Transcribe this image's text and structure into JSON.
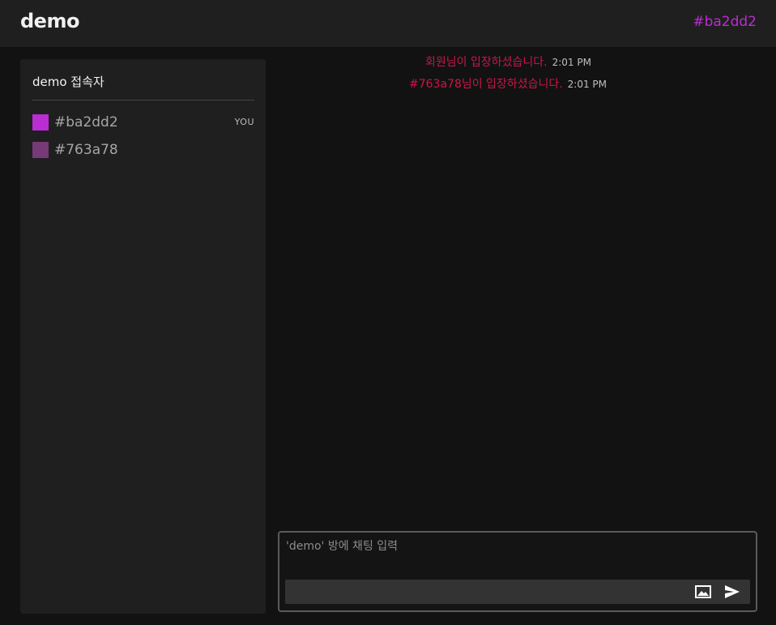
{
  "header": {
    "title": "demo",
    "current_user": "#ba2dd2",
    "current_user_color": "#ba2dd2"
  },
  "sidebar": {
    "title": "demo 접속자",
    "users": [
      {
        "name": "#ba2dd2",
        "color": "#ba2dd2",
        "tag": "YOU"
      },
      {
        "name": "#763a78",
        "color": "#763a78",
        "tag": ""
      }
    ]
  },
  "messages": [
    {
      "text": "회원님이 입장하셨습니다.",
      "time": "2:01 PM"
    },
    {
      "text": "#763a78님이 입장하셨습니다.",
      "time": "2:01 PM"
    }
  ],
  "composer": {
    "placeholder": "'demo' 방에 채팅 입력",
    "image_icon": "image-icon",
    "send_icon": "send-icon"
  },
  "colors": {
    "system_message": "#c8164a",
    "background": "#121212",
    "panel": "#1f1f1f"
  }
}
